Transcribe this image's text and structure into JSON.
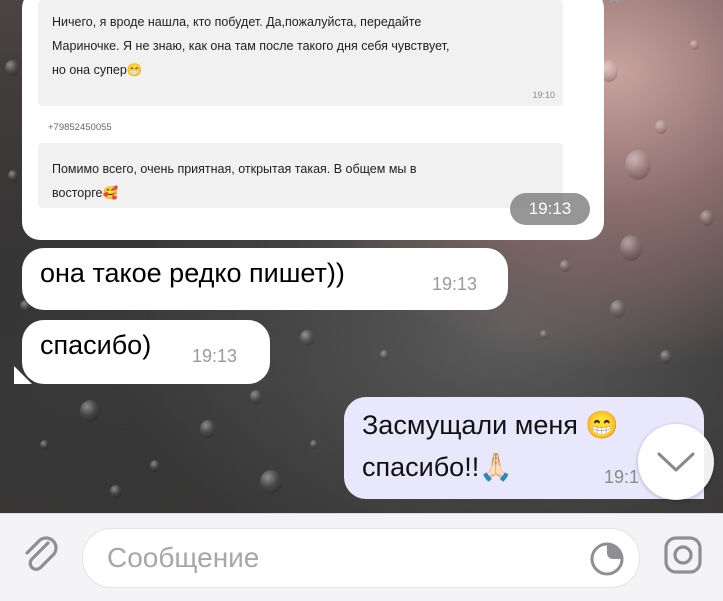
{
  "forwarded": {
    "message1": {
      "lines": [
        "Ничего, я вроде нашла, кто побудет. Да,пожалуйста, передайте",
        "Мариночке. Я не знаю, как она там после такого дня себя чувствует,",
        "но она супер"
      ],
      "emoji": "😁",
      "time": "19:10"
    },
    "sender_phone": "+79852450055",
    "message2": {
      "lines": [
        "Помимо всего, очень приятная, открытая такая. В общем мы в",
        "восторге"
      ],
      "emoji": "🥰"
    },
    "time": "19:13"
  },
  "incoming": [
    {
      "text": "она такое редко пишет))",
      "time": "19:13"
    },
    {
      "text": "спасибо)",
      "time": "19:13"
    }
  ],
  "outgoing": {
    "line1": "Засмущали меня 😁",
    "line2": "спасибо!!🙏🏻",
    "time": "19:1"
  },
  "composer": {
    "placeholder": "Сообщение"
  },
  "icons": {
    "attach": "paperclip-icon",
    "sticker": "sticker-icon",
    "camera": "camera-icon",
    "scroll_down": "chevron-down-icon",
    "share": "share-icon"
  },
  "colors": {
    "outgoing_bubble": "#e9e7fb",
    "incoming_bubble": "#ffffff",
    "input_bar": "#f4f4f6"
  }
}
